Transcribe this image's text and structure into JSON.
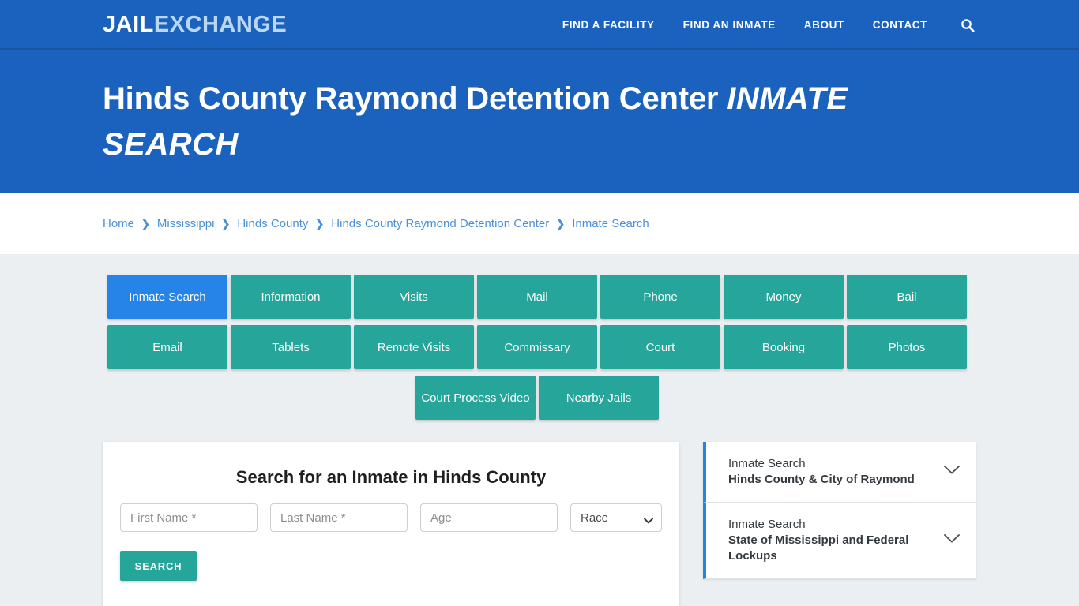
{
  "brand": {
    "logo_primary": "JAIL",
    "logo_secondary": "EXCHANGE",
    "accent_blue": "#1b62bf",
    "accent_teal": "#26a69a",
    "active_tab_blue": "#2684e8"
  },
  "nav": {
    "items": [
      {
        "label": "FIND A FACILITY"
      },
      {
        "label": "FIND AN INMATE"
      },
      {
        "label": "ABOUT"
      },
      {
        "label": "CONTACT"
      }
    ],
    "search_icon": "search-icon"
  },
  "hero": {
    "title_main": "Hinds County Raymond Detention Center",
    "title_sub": "Inmate Search"
  },
  "breadcrumb": {
    "separator": "❯",
    "items": [
      {
        "label": "Home"
      },
      {
        "label": "Mississippi"
      },
      {
        "label": "Hinds County"
      },
      {
        "label": "Hinds County Raymond Detention Center"
      },
      {
        "label": "Inmate Search"
      }
    ]
  },
  "tabs": [
    {
      "label": "Inmate Search",
      "active": true
    },
    {
      "label": "Information",
      "active": false
    },
    {
      "label": "Visits",
      "active": false
    },
    {
      "label": "Mail",
      "active": false
    },
    {
      "label": "Phone",
      "active": false
    },
    {
      "label": "Money",
      "active": false
    },
    {
      "label": "Bail",
      "active": false
    },
    {
      "label": "Email",
      "active": false
    },
    {
      "label": "Tablets",
      "active": false
    },
    {
      "label": "Remote Visits",
      "active": false
    },
    {
      "label": "Commissary",
      "active": false
    },
    {
      "label": "Court",
      "active": false
    },
    {
      "label": "Booking",
      "active": false
    },
    {
      "label": "Photos",
      "active": false
    },
    {
      "label": "Court Process Video",
      "active": false
    },
    {
      "label": "Nearby Jails",
      "active": false
    }
  ],
  "search_form": {
    "title": "Search for an Inmate in Hinds County",
    "first_name": {
      "placeholder": "First Name *",
      "value": ""
    },
    "last_name": {
      "placeholder": "Last Name *",
      "value": ""
    },
    "age": {
      "placeholder": "Age",
      "value": ""
    },
    "race": {
      "selected": "Race"
    },
    "submit_label": "SEARCH"
  },
  "sidebar": {
    "panels": [
      {
        "line1": "Inmate Search",
        "line2": "Hinds County & City of Raymond",
        "chevron": "chevron-down-icon"
      },
      {
        "line1": "Inmate Search",
        "line2": "State of Mississippi and Federal Lockups",
        "chevron": "chevron-down-icon"
      }
    ]
  }
}
